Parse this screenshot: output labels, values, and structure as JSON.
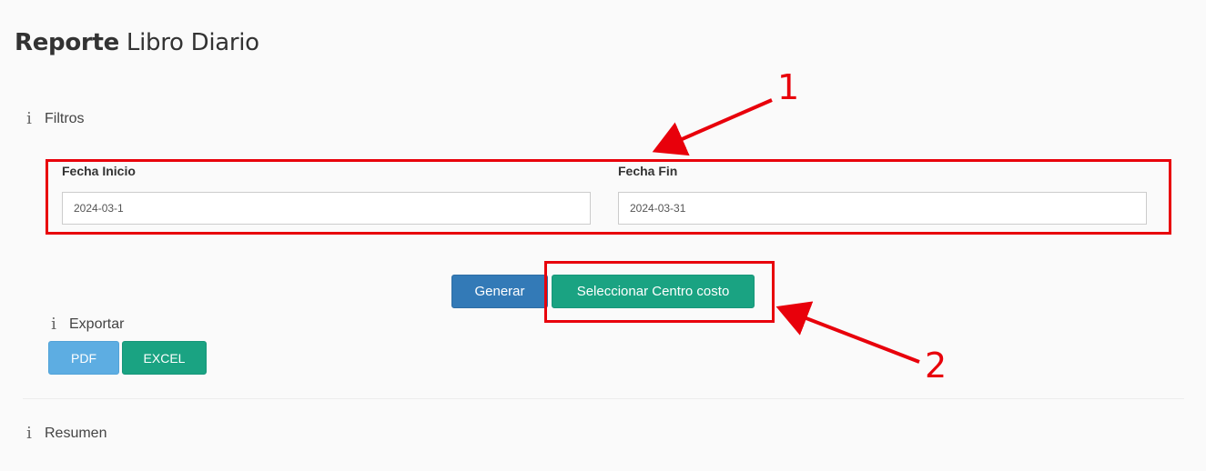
{
  "page": {
    "title_bold": "Reporte",
    "title_rest": "Libro Diario"
  },
  "filters": {
    "heading": "Filtros",
    "icon": "info-icon",
    "start_label": "Fecha Inicio",
    "start_value": "2024-03-1",
    "end_label": "Fecha Fin",
    "end_value": "2024-03-31"
  },
  "actions": {
    "generate_label": "Generar",
    "cost_center_label": "Seleccionar Centro costo"
  },
  "export": {
    "heading": "Exportar",
    "pdf_label": "PDF",
    "excel_label": "EXCEL"
  },
  "summary": {
    "heading": "Resumen"
  },
  "annotations": {
    "marker_1": "1",
    "marker_2": "2",
    "color": "#e8000b"
  },
  "colors": {
    "primary": "#337ab7",
    "teal": "#1aa382",
    "info": "#5dade2"
  }
}
